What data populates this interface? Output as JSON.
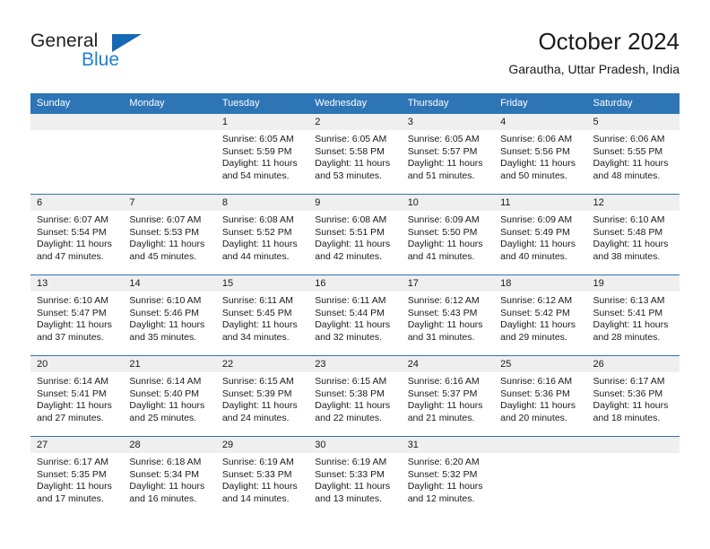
{
  "brand": {
    "name_dark": "General",
    "name_blue": "Blue",
    "accent_color": "#1f80d2",
    "triangle_color": "#1669b5"
  },
  "header": {
    "title": "October 2024",
    "subtitle": "Garautha, Uttar Pradesh, India"
  },
  "theme": {
    "header_row_bg": "#2e75b6",
    "day_band_bg": "#efefef",
    "row_divider": "#2e75b6",
    "page_bg": "#ffffff",
    "text": "#1a1a1a"
  },
  "calendar": {
    "month": "October",
    "year": 2024,
    "weekday_headers": [
      "Sunday",
      "Monday",
      "Tuesday",
      "Wednesday",
      "Thursday",
      "Friday",
      "Saturday"
    ],
    "weeks": [
      [
        {
          "day": "",
          "lines": []
        },
        {
          "day": "",
          "lines": []
        },
        {
          "day": "1",
          "lines": [
            "Sunrise: 6:05 AM",
            "Sunset: 5:59 PM",
            "Daylight: 11 hours",
            "and 54 minutes."
          ]
        },
        {
          "day": "2",
          "lines": [
            "Sunrise: 6:05 AM",
            "Sunset: 5:58 PM",
            "Daylight: 11 hours",
            "and 53 minutes."
          ]
        },
        {
          "day": "3",
          "lines": [
            "Sunrise: 6:05 AM",
            "Sunset: 5:57 PM",
            "Daylight: 11 hours",
            "and 51 minutes."
          ]
        },
        {
          "day": "4",
          "lines": [
            "Sunrise: 6:06 AM",
            "Sunset: 5:56 PM",
            "Daylight: 11 hours",
            "and 50 minutes."
          ]
        },
        {
          "day": "5",
          "lines": [
            "Sunrise: 6:06 AM",
            "Sunset: 5:55 PM",
            "Daylight: 11 hours",
            "and 48 minutes."
          ]
        }
      ],
      [
        {
          "day": "6",
          "lines": [
            "Sunrise: 6:07 AM",
            "Sunset: 5:54 PM",
            "Daylight: 11 hours",
            "and 47 minutes."
          ]
        },
        {
          "day": "7",
          "lines": [
            "Sunrise: 6:07 AM",
            "Sunset: 5:53 PM",
            "Daylight: 11 hours",
            "and 45 minutes."
          ]
        },
        {
          "day": "8",
          "lines": [
            "Sunrise: 6:08 AM",
            "Sunset: 5:52 PM",
            "Daylight: 11 hours",
            "and 44 minutes."
          ]
        },
        {
          "day": "9",
          "lines": [
            "Sunrise: 6:08 AM",
            "Sunset: 5:51 PM",
            "Daylight: 11 hours",
            "and 42 minutes."
          ]
        },
        {
          "day": "10",
          "lines": [
            "Sunrise: 6:09 AM",
            "Sunset: 5:50 PM",
            "Daylight: 11 hours",
            "and 41 minutes."
          ]
        },
        {
          "day": "11",
          "lines": [
            "Sunrise: 6:09 AM",
            "Sunset: 5:49 PM",
            "Daylight: 11 hours",
            "and 40 minutes."
          ]
        },
        {
          "day": "12",
          "lines": [
            "Sunrise: 6:10 AM",
            "Sunset: 5:48 PM",
            "Daylight: 11 hours",
            "and 38 minutes."
          ]
        }
      ],
      [
        {
          "day": "13",
          "lines": [
            "Sunrise: 6:10 AM",
            "Sunset: 5:47 PM",
            "Daylight: 11 hours",
            "and 37 minutes."
          ]
        },
        {
          "day": "14",
          "lines": [
            "Sunrise: 6:10 AM",
            "Sunset: 5:46 PM",
            "Daylight: 11 hours",
            "and 35 minutes."
          ]
        },
        {
          "day": "15",
          "lines": [
            "Sunrise: 6:11 AM",
            "Sunset: 5:45 PM",
            "Daylight: 11 hours",
            "and 34 minutes."
          ]
        },
        {
          "day": "16",
          "lines": [
            "Sunrise: 6:11 AM",
            "Sunset: 5:44 PM",
            "Daylight: 11 hours",
            "and 32 minutes."
          ]
        },
        {
          "day": "17",
          "lines": [
            "Sunrise: 6:12 AM",
            "Sunset: 5:43 PM",
            "Daylight: 11 hours",
            "and 31 minutes."
          ]
        },
        {
          "day": "18",
          "lines": [
            "Sunrise: 6:12 AM",
            "Sunset: 5:42 PM",
            "Daylight: 11 hours",
            "and 29 minutes."
          ]
        },
        {
          "day": "19",
          "lines": [
            "Sunrise: 6:13 AM",
            "Sunset: 5:41 PM",
            "Daylight: 11 hours",
            "and 28 minutes."
          ]
        }
      ],
      [
        {
          "day": "20",
          "lines": [
            "Sunrise: 6:14 AM",
            "Sunset: 5:41 PM",
            "Daylight: 11 hours",
            "and 27 minutes."
          ]
        },
        {
          "day": "21",
          "lines": [
            "Sunrise: 6:14 AM",
            "Sunset: 5:40 PM",
            "Daylight: 11 hours",
            "and 25 minutes."
          ]
        },
        {
          "day": "22",
          "lines": [
            "Sunrise: 6:15 AM",
            "Sunset: 5:39 PM",
            "Daylight: 11 hours",
            "and 24 minutes."
          ]
        },
        {
          "day": "23",
          "lines": [
            "Sunrise: 6:15 AM",
            "Sunset: 5:38 PM",
            "Daylight: 11 hours",
            "and 22 minutes."
          ]
        },
        {
          "day": "24",
          "lines": [
            "Sunrise: 6:16 AM",
            "Sunset: 5:37 PM",
            "Daylight: 11 hours",
            "and 21 minutes."
          ]
        },
        {
          "day": "25",
          "lines": [
            "Sunrise: 6:16 AM",
            "Sunset: 5:36 PM",
            "Daylight: 11 hours",
            "and 20 minutes."
          ]
        },
        {
          "day": "26",
          "lines": [
            "Sunrise: 6:17 AM",
            "Sunset: 5:36 PM",
            "Daylight: 11 hours",
            "and 18 minutes."
          ]
        }
      ],
      [
        {
          "day": "27",
          "lines": [
            "Sunrise: 6:17 AM",
            "Sunset: 5:35 PM",
            "Daylight: 11 hours",
            "and 17 minutes."
          ]
        },
        {
          "day": "28",
          "lines": [
            "Sunrise: 6:18 AM",
            "Sunset: 5:34 PM",
            "Daylight: 11 hours",
            "and 16 minutes."
          ]
        },
        {
          "day": "29",
          "lines": [
            "Sunrise: 6:19 AM",
            "Sunset: 5:33 PM",
            "Daylight: 11 hours",
            "and 14 minutes."
          ]
        },
        {
          "day": "30",
          "lines": [
            "Sunrise: 6:19 AM",
            "Sunset: 5:33 PM",
            "Daylight: 11 hours",
            "and 13 minutes."
          ]
        },
        {
          "day": "31",
          "lines": [
            "Sunrise: 6:20 AM",
            "Sunset: 5:32 PM",
            "Daylight: 11 hours",
            "and 12 minutes."
          ]
        },
        {
          "day": "",
          "lines": []
        },
        {
          "day": "",
          "lines": []
        }
      ]
    ]
  }
}
